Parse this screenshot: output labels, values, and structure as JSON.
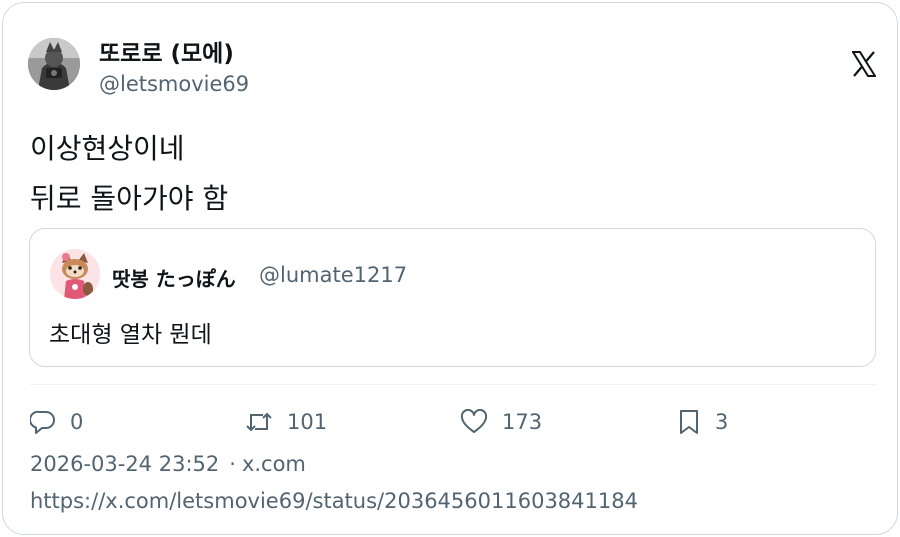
{
  "author": {
    "display_name": "또로로 (모에)",
    "handle": "@letsmovie69",
    "avatar_icon": "user-avatar-photo"
  },
  "platform_icon": "x-logo-icon",
  "tweet": {
    "lines": [
      "이상현상이네",
      "뒤로 돌아가야 함"
    ]
  },
  "quoted_tweet": {
    "display_name": "땃봉 たっぽん",
    "handle": "@lumate1217",
    "text": "초대형 열차 뭔데",
    "avatar_icon": "raccoon-avatar"
  },
  "actions": {
    "reply": {
      "icon": "reply-icon",
      "count": "0"
    },
    "retweet": {
      "icon": "retweet-icon",
      "count": "101"
    },
    "like": {
      "icon": "heart-icon",
      "count": "173"
    },
    "bookmark": {
      "icon": "bookmark-icon",
      "count": "3"
    }
  },
  "meta": {
    "timestamp": "2026-03-24 23:52",
    "separator": "·",
    "source": "x.com"
  },
  "url": "https://x.com/letsmovie69/status/2036456011603841184",
  "colors": {
    "text_primary": "#0f1419",
    "text_secondary": "#536471",
    "border": "#cfd9de"
  }
}
